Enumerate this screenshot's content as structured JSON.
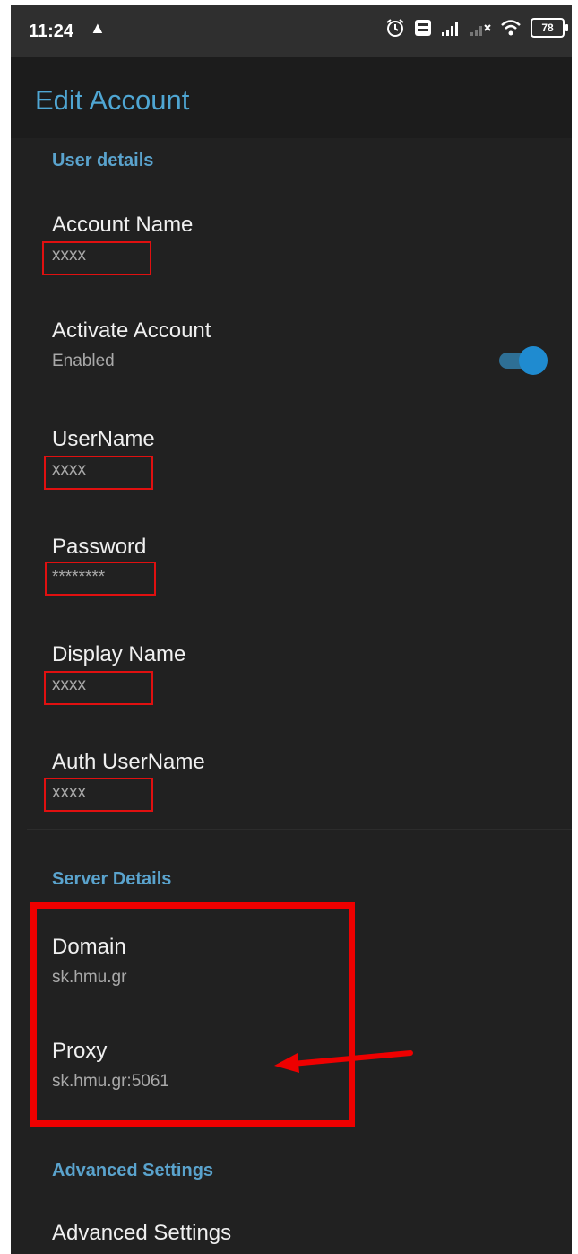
{
  "status_bar": {
    "time": "11:24",
    "alert_glyph": "▲",
    "icons": [
      "alarm-icon",
      "volte-icon",
      "signal-icon",
      "signal-no-service-icon",
      "wifi-icon"
    ],
    "battery": "78"
  },
  "app_bar": {
    "title": "Edit Account"
  },
  "sections": {
    "user_details": {
      "header": "User details",
      "account_name": {
        "title": "Account Name",
        "value": "xxxx"
      },
      "activate_account": {
        "title": "Activate Account",
        "summary": "Enabled",
        "toggle_on": true
      },
      "username": {
        "title": "UserName",
        "value": "xxxx"
      },
      "password": {
        "title": "Password",
        "value": "********"
      },
      "display_name": {
        "title": "Display Name",
        "value": "xxxx"
      },
      "auth_username": {
        "title": "Auth UserName",
        "value": "xxxx"
      }
    },
    "server_details": {
      "header": "Server Details",
      "domain": {
        "title": "Domain",
        "value": "sk.hmu.gr"
      },
      "proxy": {
        "title": "Proxy",
        "value": "sk.hmu.gr:5061"
      }
    },
    "advanced": {
      "header": "Advanced Settings",
      "item": {
        "title": "Advanced Settings"
      }
    }
  },
  "colors": {
    "background": "#212121",
    "status_bar": "#2f2f2f",
    "accent": "#4fa6d3",
    "annotation_red": "#ee0000",
    "toggle_thumb": "#1f8bd0"
  }
}
